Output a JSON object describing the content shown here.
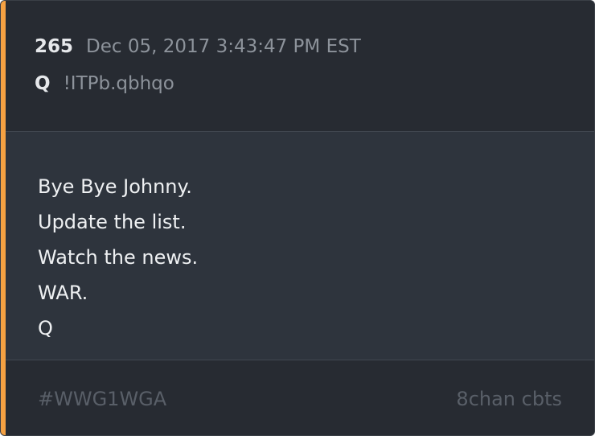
{
  "post": {
    "number": "265",
    "timestamp": "Dec 05, 2017 3:43:47 PM EST",
    "author": "Q",
    "tripcode": "!ITPb.qbhqo",
    "lines": [
      "Bye Bye Johnny.",
      "Update the list.",
      "Watch the news.",
      "WAR.",
      "Q"
    ]
  },
  "footer": {
    "hashtag": "#WWG1WGA",
    "source": "8chan cbts"
  },
  "colors": {
    "accent": "#f5a142",
    "header_bg": "#272b32",
    "body_bg": "#2e343d",
    "muted_text": "#8d939b",
    "footer_text": "#595f68"
  }
}
